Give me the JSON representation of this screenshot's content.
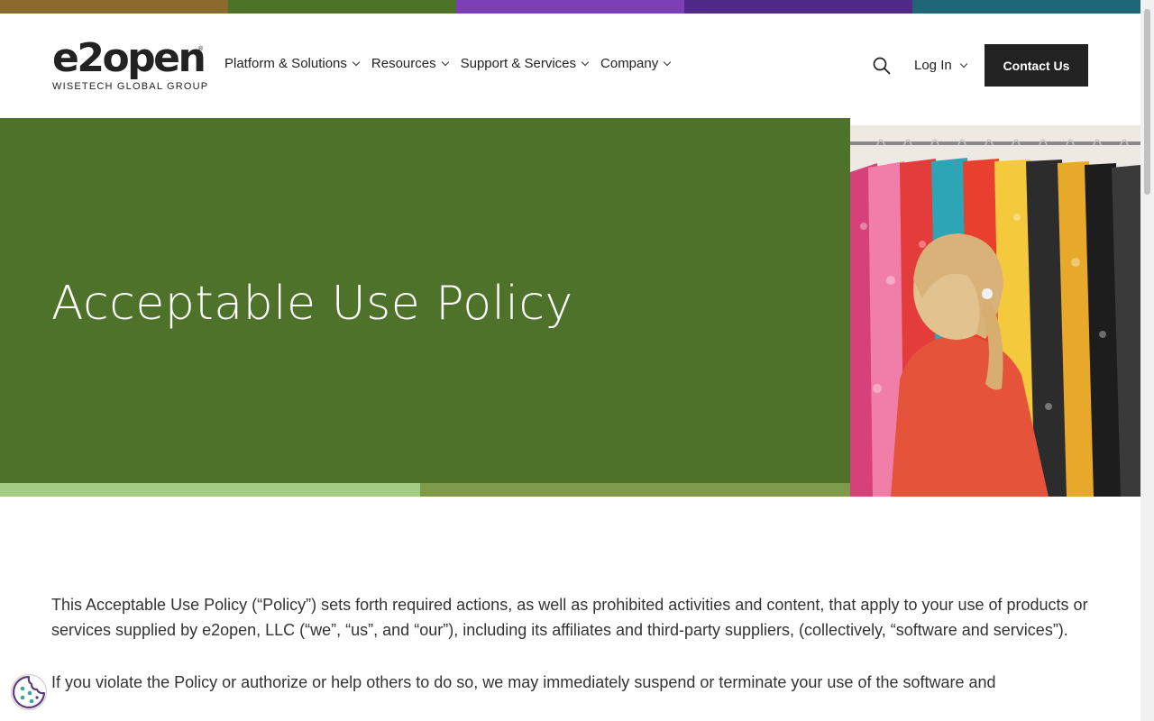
{
  "colors": {
    "top_bar": [
      "#8c6a2d",
      "#4d7329",
      "#7d3fb5",
      "#502a88",
      "#1e6677"
    ],
    "hero_bg": "#4e722a",
    "hero_strip": [
      "#a4cd84",
      "#7e9a4b"
    ],
    "button_bg": "#222222"
  },
  "logo": {
    "word": "e2open",
    "reg": "®",
    "sub": "WISETECH GLOBAL GROUP"
  },
  "nav": {
    "items": [
      {
        "label": "Platform & Solutions"
      },
      {
        "label": "Resources"
      },
      {
        "label": "Support & Services"
      },
      {
        "label": "Company"
      }
    ]
  },
  "header": {
    "search_icon": "search-icon",
    "login_label": "Log In",
    "contact_label": "Contact Us"
  },
  "hero": {
    "title": "Acceptable Use Policy",
    "image": "woman-browsing-clothing-rack"
  },
  "content": {
    "paragraphs": [
      "This Acceptable Use Policy (“Policy”) sets forth required actions, as well as prohibited activities and content, that apply to your use of products or services supplied by e2open, LLC (“we”, “us”, and “our”), including its affiliates and third-party suppliers, (collectively, “software and services”).",
      "If you violate the Policy or authorize or help others to do so, we may immediately suspend or terminate your use of the software and"
    ]
  },
  "cookie": {
    "icon": "cookie-icon"
  }
}
